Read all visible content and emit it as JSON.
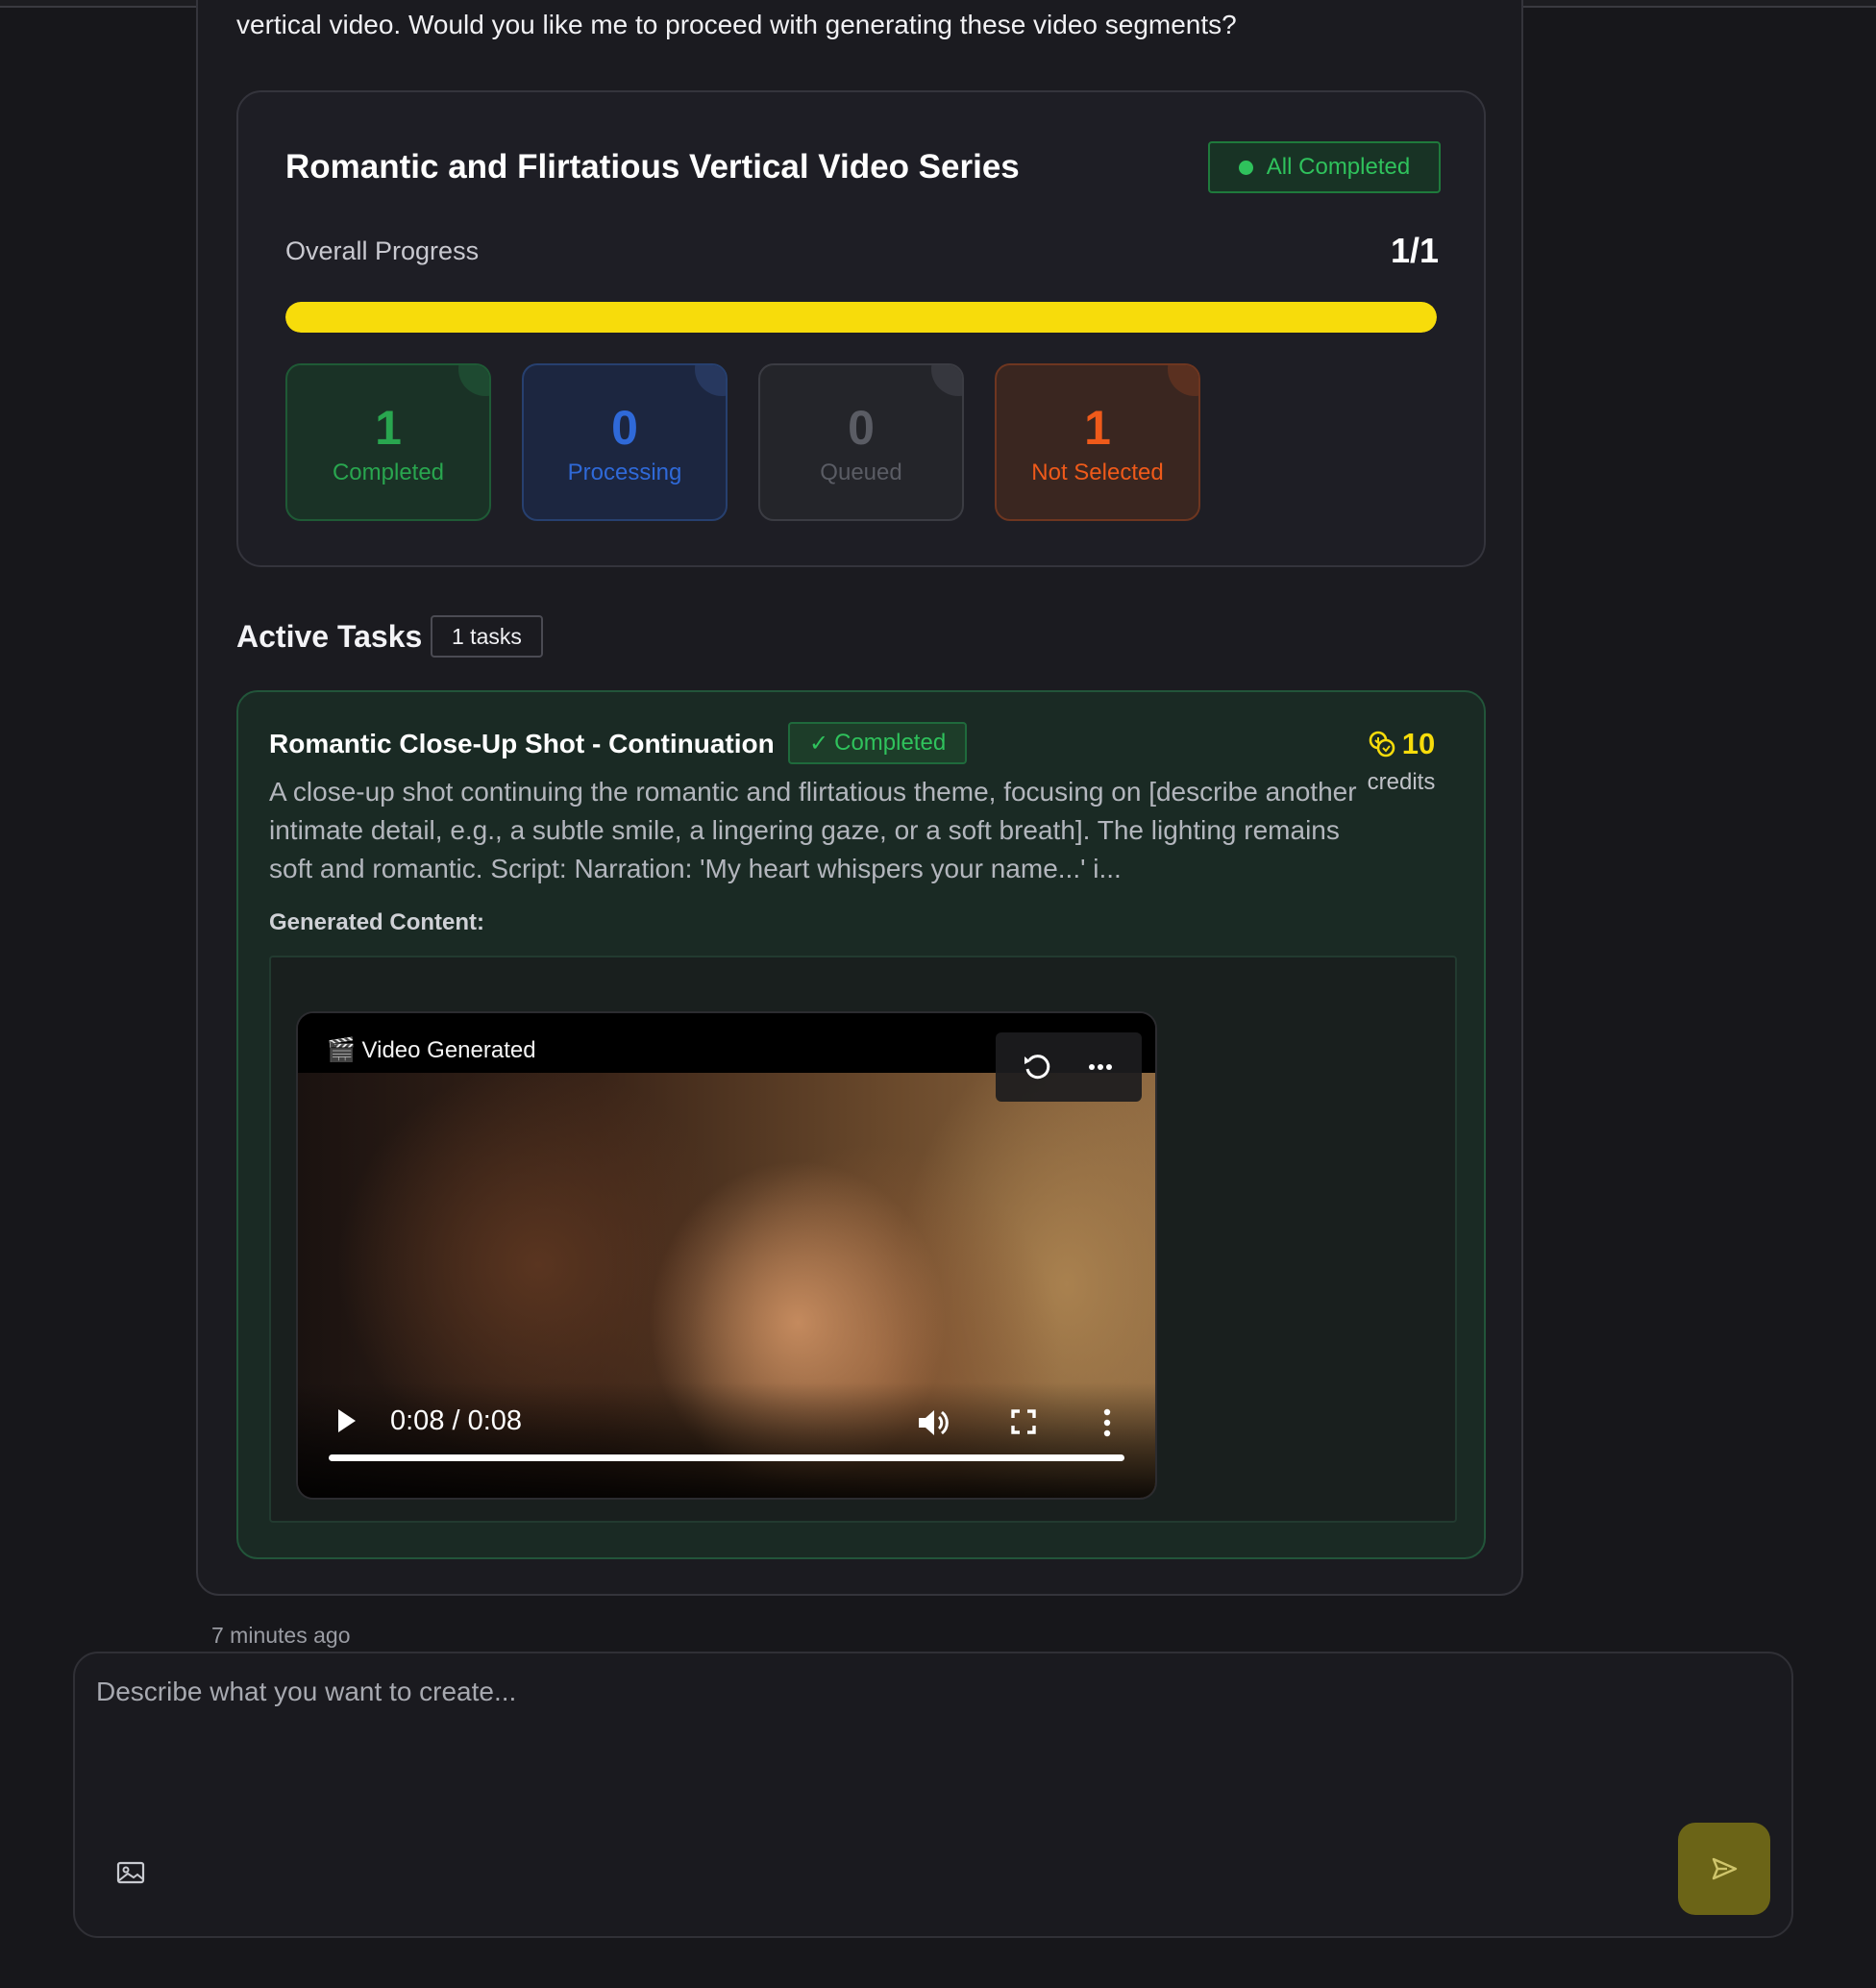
{
  "message": {
    "intro_text": "vertical video. Would you like me to proceed with generating these video segments?",
    "timestamp": "7 minutes ago"
  },
  "series": {
    "title": "Romantic and Flirtatious Vertical Video Series",
    "status": "All Completed",
    "overall_label": "Overall Progress",
    "overall_value": "1/1",
    "progress_fraction": 1.0,
    "progress_color": "#f7dc0b",
    "stats": [
      {
        "value": "1",
        "label": "Completed"
      },
      {
        "value": "0",
        "label": "Processing"
      },
      {
        "value": "0",
        "label": "Queued"
      },
      {
        "value": "1",
        "label": "Not Selected"
      }
    ]
  },
  "active_tasks": {
    "title": "Active Tasks",
    "count_label": "1 tasks",
    "task": {
      "title": "Romantic Close-Up Shot - Continuation",
      "status": "Completed",
      "status_icon": "check-icon",
      "credits_value": "10",
      "credits_label": "credits",
      "description": "A close-up shot continuing the romantic and flirtatious theme, focusing on [describe another intimate detail, e.g., a subtle smile, a lingering gaze, or a soft breath]. The lighting remains soft and romantic. Script: Narration: 'My heart whispers your name...' i...",
      "generated_label": "Generated Content:",
      "video": {
        "label": "🎬 Video Generated",
        "time": "0:08 / 0:08",
        "progress_fraction": 1.0
      }
    }
  },
  "composer": {
    "placeholder": "Describe what you want to create..."
  },
  "colors": {
    "accent_yellow": "#f7dc0b",
    "success_green": "#2fc25c",
    "processing_blue": "#2f69d8",
    "not_selected_orange": "#ef5a1a"
  }
}
